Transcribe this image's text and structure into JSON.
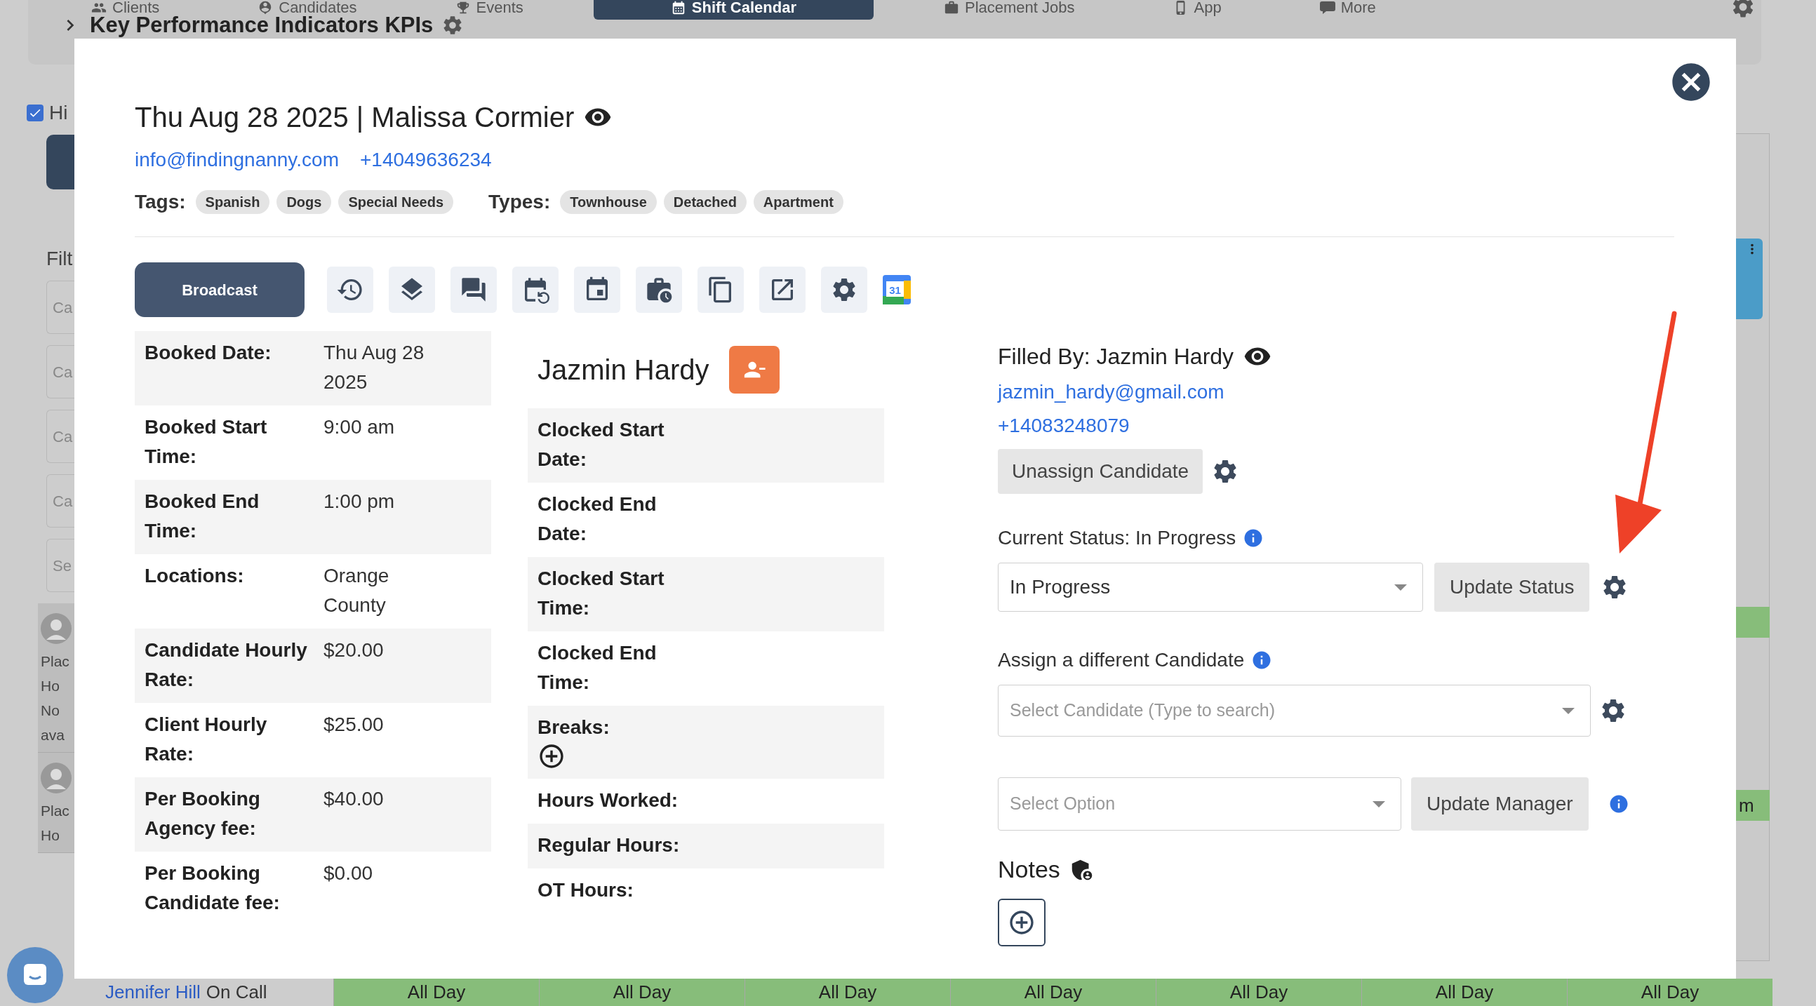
{
  "background": {
    "nav": [
      {
        "label": "Clients",
        "selected": false
      },
      {
        "label": "Candidates",
        "selected": false
      },
      {
        "label": "Events",
        "selected": false
      },
      {
        "label": "Shift Calendar",
        "selected": true
      },
      {
        "label": "Placement Jobs",
        "selected": false
      },
      {
        "label": "App",
        "selected": false
      },
      {
        "label": "More",
        "selected": false
      }
    ],
    "page_title": "Key Performance Indicators KPIs",
    "sidebar": {
      "checkbox": {
        "label": "Hi",
        "checked": true
      },
      "filter_label": "Filt",
      "fields": [
        {
          "placeholder": "Ca"
        },
        {
          "placeholder": "Ca"
        },
        {
          "placeholder": "Ca"
        },
        {
          "placeholder": "Ca"
        },
        {
          "placeholder": "Se"
        }
      ],
      "cards": [
        {
          "lines": [
            "Plac",
            "Ho",
            "No",
            "ava"
          ]
        },
        {
          "lines": [
            "Plac",
            "Ho"
          ]
        }
      ]
    },
    "right_cell_text": "m",
    "footer": {
      "name": "Jennifer Hill",
      "status": "On Call",
      "cells": [
        "All Day",
        "All Day",
        "All Day",
        "All Day",
        "All Day",
        "All Day",
        "All Day"
      ]
    }
  },
  "modal": {
    "title": "Thu Aug 28 2025 | Malissa Cormier",
    "email": "info@findingnanny.com",
    "phone": "+14049636234",
    "tags_label": "Tags:",
    "tags": [
      "Spanish",
      "Dogs",
      "Special Needs"
    ],
    "types_label": "Types:",
    "types": [
      "Townhouse",
      "Detached",
      "Apartment"
    ],
    "broadcast": "Broadcast",
    "calendar_day": "31",
    "booking": [
      {
        "label": "Booked Date:",
        "value": "Thu Aug 28 2025"
      },
      {
        "label": "Booked Start Time:",
        "value": "9:00 am"
      },
      {
        "label": "Booked End Time:",
        "value": "1:00 pm"
      },
      {
        "label": "Locations:",
        "value": "Orange County"
      },
      {
        "label": "Candidate Hourly Rate:",
        "value": "$20.00"
      },
      {
        "label": "Client Hourly Rate:",
        "value": "$25.00"
      },
      {
        "label": "Per Booking Agency fee:",
        "value": "$40.00"
      },
      {
        "label": "Per Booking Candidate fee:",
        "value": "$0.00"
      }
    ],
    "candidate_name": "Jazmin Hardy",
    "clock": [
      {
        "label": "Clocked Start Date:",
        "kind": "text"
      },
      {
        "label": "Clocked End Date:",
        "kind": "text"
      },
      {
        "label": "Clocked Start Time:",
        "kind": "text"
      },
      {
        "label": "Clocked End Time:",
        "kind": "text"
      },
      {
        "label": "Breaks:",
        "kind": "add"
      },
      {
        "label": "Hours Worked:",
        "kind": "text"
      },
      {
        "label": "Regular Hours:",
        "kind": "text"
      },
      {
        "label": "OT Hours:",
        "kind": "text"
      }
    ],
    "filled_by": "Filled By: Jazmin Hardy",
    "filled_email": "jazmin_hardy@gmail.com",
    "filled_phone": "+14083248079",
    "unassign": "Unassign Candidate",
    "status_label": "Current Status: In Progress",
    "status_value": "In Progress",
    "update_status": "Update Status",
    "assign_label": "Assign a different Candidate",
    "candidate_placeholder": "Select Candidate (Type to search)",
    "option_placeholder": "Select Option",
    "update_manager": "Update Manager",
    "notes_label": "Notes"
  }
}
